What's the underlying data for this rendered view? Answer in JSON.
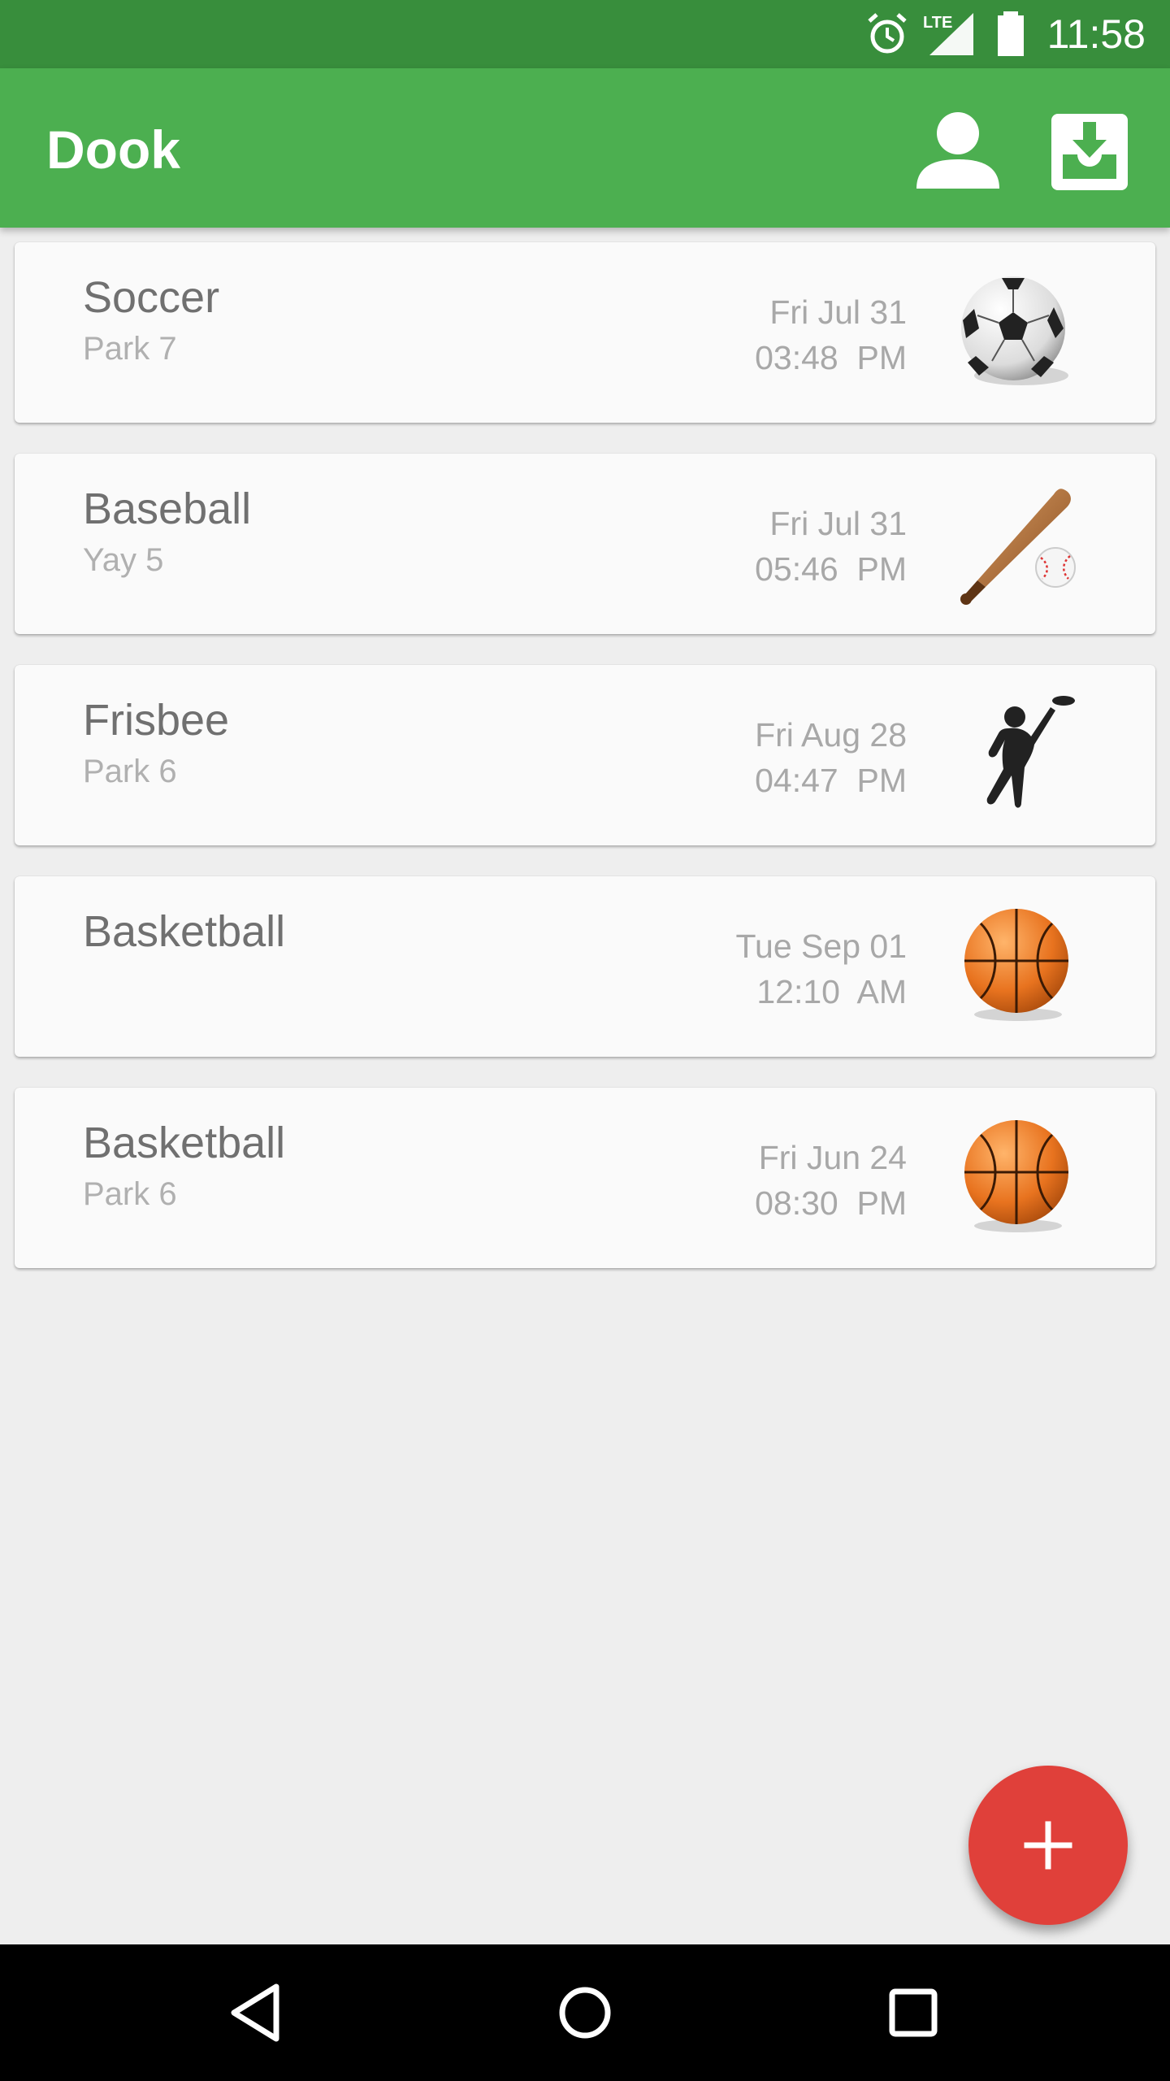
{
  "status_bar": {
    "time": "11:58",
    "icons": [
      "alarm-icon",
      "lte-signal-icon",
      "battery-icon"
    ],
    "network_label": "LTE"
  },
  "app_bar": {
    "title": "Dook",
    "background_color": "#4caf50",
    "actions": [
      "profile-icon",
      "inbox-download-icon"
    ]
  },
  "events": [
    {
      "title": "Soccer",
      "location": "Park 7",
      "date": "Fri Jul 31",
      "time": "03:48  PM",
      "icon": "soccer-ball-icon"
    },
    {
      "title": "Baseball",
      "location": "Yay 5",
      "date": "Fri Jul 31",
      "time": "05:46  PM",
      "icon": "baseball-bat-icon"
    },
    {
      "title": "Frisbee",
      "location": "Park 6",
      "date": "Fri Aug 28",
      "time": "04:47  PM",
      "icon": "frisbee-player-icon"
    },
    {
      "title": "Basketball",
      "location": "",
      "date": "Tue Sep 01",
      "time": "12:10  AM",
      "icon": "basketball-icon"
    },
    {
      "title": "Basketball",
      "location": "Park 6",
      "date": "Fri Jun 24",
      "time": "08:30  PM",
      "icon": "basketball-icon"
    }
  ],
  "fab": {
    "icon": "plus-icon",
    "color": "#e0403a"
  },
  "nav_bar": {
    "buttons": [
      "back-icon",
      "home-icon",
      "recents-icon"
    ]
  }
}
